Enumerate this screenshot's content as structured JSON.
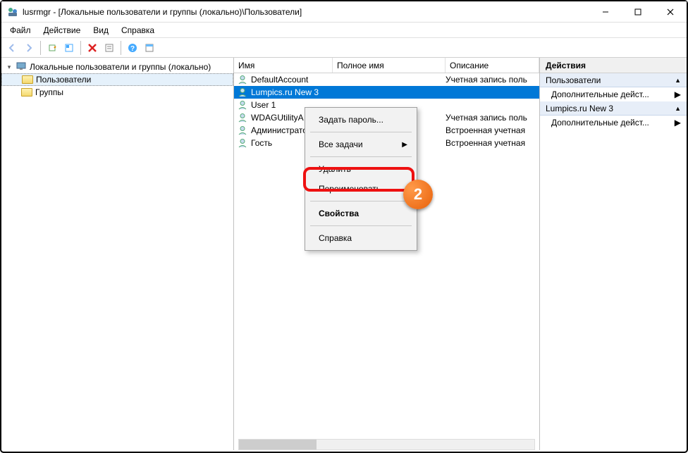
{
  "window": {
    "title": "lusrmgr - [Локальные пользователи и группы (локально)\\Пользователи]"
  },
  "menu": {
    "file": "Файл",
    "action": "Действие",
    "view": "Вид",
    "help": "Справка"
  },
  "tree": {
    "root": "Локальные пользователи и группы (локально)",
    "users": "Пользователи",
    "groups": "Группы"
  },
  "columns": {
    "name": "Имя",
    "full": "Полное имя",
    "desc": "Описание"
  },
  "rows": [
    {
      "name": "DefaultAccount",
      "full": "",
      "desc": "Учетная запись поль"
    },
    {
      "name": "Lumpics.ru New 3",
      "full": "",
      "desc": ""
    },
    {
      "name": "User 1",
      "full": "",
      "desc": ""
    },
    {
      "name": "WDAGUtilityA",
      "full": "",
      "desc": "Учетная запись поль"
    },
    {
      "name": "Администрато",
      "full": "",
      "desc": "Встроенная учетная"
    },
    {
      "name": "Гость",
      "full": "",
      "desc": "Встроенная учетная"
    }
  ],
  "ctx": {
    "set_pw": "Задать пароль...",
    "all_tasks": "Все задачи",
    "delete": "Удалить",
    "rename": "Переименовать",
    "props": "Свойства",
    "help": "Справка"
  },
  "actions": {
    "title": "Действия",
    "group1": "Пользователи",
    "more1": "Дополнительные дейст...",
    "group2": "Lumpics.ru New 3",
    "more2": "Дополнительные дейст..."
  },
  "badge": "2"
}
